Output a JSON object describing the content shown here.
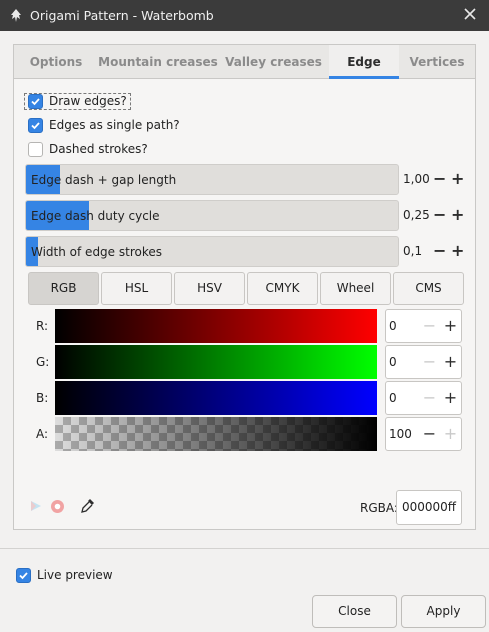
{
  "window": {
    "title": "Origami Pattern - Waterbomb",
    "app_icon": "inkscape-icon",
    "close_icon": "close-icon"
  },
  "tabs": [
    {
      "label": "Options",
      "active": false
    },
    {
      "label": "Mountain creases",
      "active": false
    },
    {
      "label": "Valley creases",
      "active": false
    },
    {
      "label": "Edge",
      "active": true
    },
    {
      "label": "Vertices",
      "active": false
    }
  ],
  "checkboxes": [
    {
      "label": "Draw edges?",
      "checked": true
    },
    {
      "label": "Edges as single path?",
      "checked": true
    },
    {
      "label": "Dashed strokes?",
      "checked": false
    }
  ],
  "spin_scales": [
    {
      "label": "Edge dash + gap length",
      "value": "1,00",
      "fill_fraction": 0.09
    },
    {
      "label": "Edge dash duty cycle",
      "value": "0,25",
      "fill_fraction": 0.25
    },
    {
      "label": "Width of edge strokes",
      "value": "0,1",
      "fill_fraction": 0.03
    }
  ],
  "spin_buttons": {
    "minus": "−",
    "plus": "+"
  },
  "color_modes": [
    {
      "label": "RGB",
      "active": true
    },
    {
      "label": "HSL",
      "active": false
    },
    {
      "label": "HSV",
      "active": false
    },
    {
      "label": "CMYK",
      "active": false
    },
    {
      "label": "Wheel",
      "active": false
    },
    {
      "label": "CMS",
      "active": false
    }
  ],
  "channels": [
    {
      "label": "R:",
      "value": "0",
      "gradient_end": "#ff0000"
    },
    {
      "label": "G:",
      "value": "0",
      "gradient_end": "#00ff00"
    },
    {
      "label": "B:",
      "value": "0",
      "gradient_end": "#0000ff"
    },
    {
      "label": "A:",
      "value": "100",
      "gradient_end": "#000000"
    }
  ],
  "color_tools": {
    "managed_icon": "color-managed-icon",
    "out_of_gamut_icon": "out-of-gamut-icon",
    "picker_icon": "eyedropper-icon"
  },
  "rgba": {
    "label": "RGBA:",
    "value": "000000ff"
  },
  "live_preview": {
    "label": "Live preview",
    "checked": true
  },
  "buttons": {
    "close": "Close",
    "apply": "Apply"
  },
  "colors": {
    "accent": "#3584e4",
    "titlebar": "#3b3b3b",
    "background": "#f2f1f0"
  }
}
